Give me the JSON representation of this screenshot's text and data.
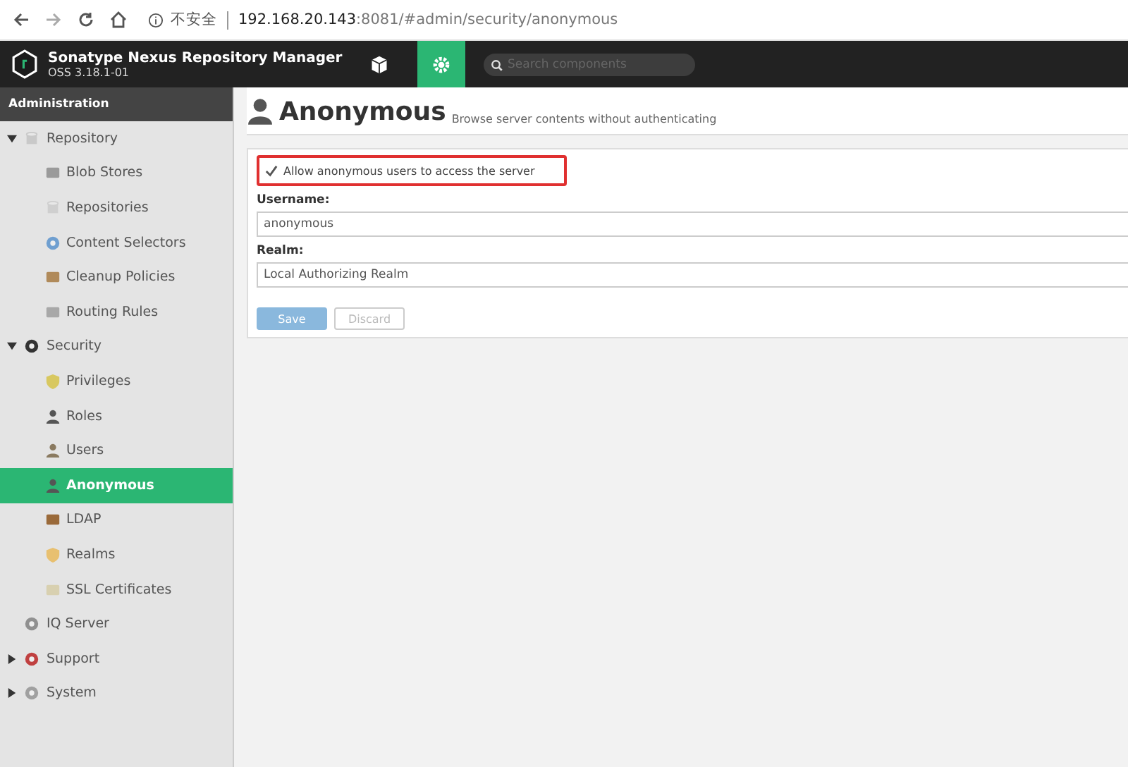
{
  "browser": {
    "security_label": "不安全",
    "url_host": "192.168.20.143",
    "url_path": ":8081/#admin/security/anonymous"
  },
  "app": {
    "title": "Sonatype Nexus Repository Manager",
    "version": "OSS 3.18.1-01"
  },
  "toolbar": [
    {
      "kind": "browse",
      "selected": false
    },
    {
      "kind": "admin",
      "selected": true
    }
  ],
  "search": {
    "placeholder": "Search components"
  },
  "sidebar": {
    "header": "Administration",
    "items": [
      {
        "label": "Repository",
        "expanded": true,
        "selected": false,
        "children": [
          {
            "label": "Blob Stores",
            "selected": false
          },
          {
            "label": "Repositories",
            "selected": false
          },
          {
            "label": "Content Selectors",
            "selected": false
          },
          {
            "label": "Cleanup Policies",
            "selected": false
          },
          {
            "label": "Routing Rules",
            "selected": false
          }
        ]
      },
      {
        "label": "Security",
        "expanded": true,
        "selected": false,
        "children": [
          {
            "label": "Privileges",
            "selected": false
          },
          {
            "label": "Roles",
            "selected": false
          },
          {
            "label": "Users",
            "selected": false
          },
          {
            "label": "Anonymous",
            "selected": true
          },
          {
            "label": "LDAP",
            "selected": false
          },
          {
            "label": "Realms",
            "selected": false
          },
          {
            "label": "SSL Certificates",
            "selected": false
          }
        ]
      },
      {
        "label": "IQ Server",
        "selected": false
      },
      {
        "label": "Support",
        "expanded": false,
        "selected": false
      },
      {
        "label": "System",
        "expanded": false,
        "selected": false
      }
    ]
  },
  "page": {
    "title": "Anonymous",
    "subtitle": "Browse server contents without authenticating"
  },
  "form": {
    "checkbox": {
      "label": "Allow anonymous users to access the server",
      "checked": true,
      "highlighted": true
    },
    "fields": [
      {
        "label": "Username:",
        "value": "anonymous"
      },
      {
        "label": "Realm:",
        "value": "Local Authorizing Realm"
      }
    ],
    "buttons": [
      {
        "label": "Save",
        "kind": "primary",
        "disabled": true
      },
      {
        "label": "Discard",
        "kind": "secondary",
        "disabled": true
      }
    ]
  }
}
